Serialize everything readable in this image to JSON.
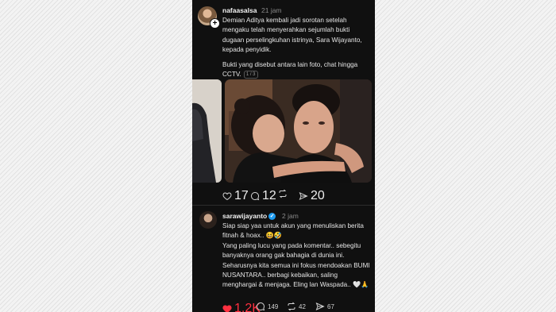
{
  "post1": {
    "username": "nafaasalsa",
    "time": "21 jam",
    "paragraph1": "Demian Aditya kembali jadi sorotan setelah mengaku telah menyerahkan sejumlah bukti dugaan perselingkuhan istrinya, Sara Wijayanto, kepada penyidik.",
    "paragraph2": "Bukti yang disebut antara lain foto, chat hingga CCTV.",
    "pager": "1 / 3",
    "likes": "17",
    "comments": "12",
    "shares": "20",
    "icons": [
      "heart-icon",
      "comment-icon",
      "repost-icon",
      "share-icon"
    ]
  },
  "post2": {
    "username": "sarawijayanto",
    "time": "2 jam",
    "paragraph1": "Siap siap yaa untuk akun yang menuliskan berita fitnah & hoax.. 😆🤣",
    "paragraph2": "Yang paling lucu yang pada komentar.. sebegitu banyaknya orang gak bahagia di dunia ini.",
    "paragraph3": "Seharusnya kita semua ini fokus mendoakan BUMI NUSANTARA.. berbagi kebaikan, saling menghargai & menjaga. Eling lan Waspada.. 🤍🙏",
    "likes": "1,2K",
    "comments": "149",
    "reposts": "42",
    "shares": "67",
    "like_color": "#ff3040"
  },
  "colors": {
    "background": "#101010",
    "verified": "#1d9bf0"
  }
}
